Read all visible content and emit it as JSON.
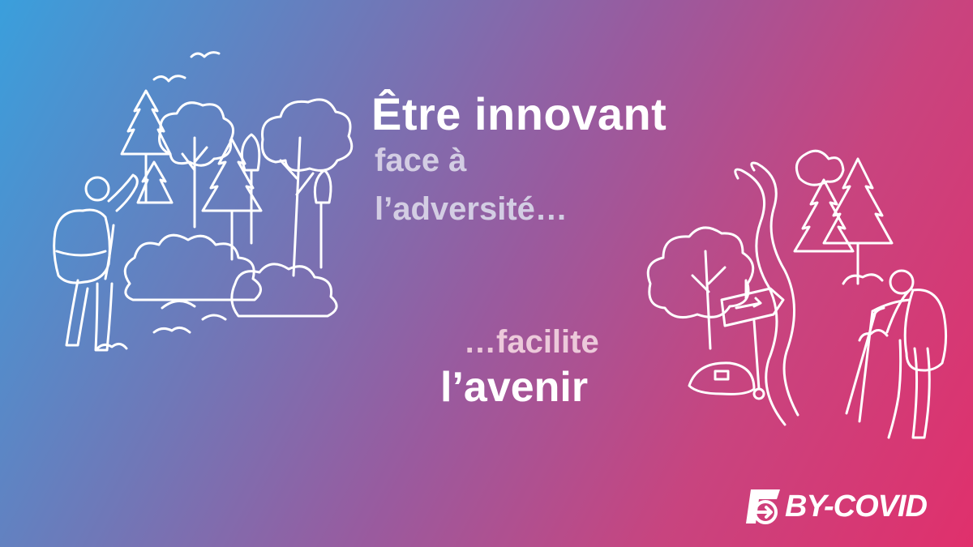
{
  "headline": {
    "line1": "Être innovant",
    "line2": "face à",
    "line3": "l’adversité…",
    "line4": "…facilite",
    "line5": "l’avenir"
  },
  "logo": {
    "text": "BY-COVID"
  },
  "colors": {
    "gradient_start": "#3a9fdc",
    "gradient_mid": "#9a5a9e",
    "gradient_end": "#e0306c",
    "primary_text": "#ffffff",
    "secondary_text": "#d3cde3"
  }
}
